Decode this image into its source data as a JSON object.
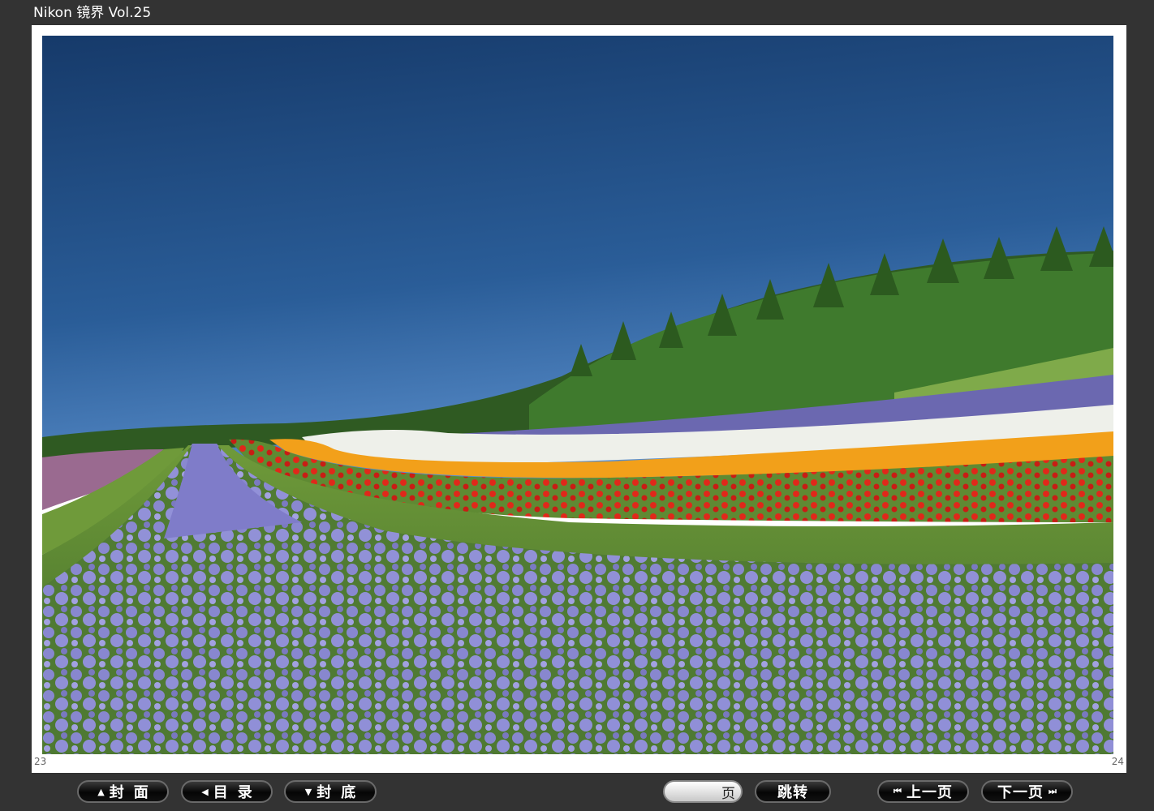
{
  "window": {
    "title": "Nikon 镜界 Vol.25"
  },
  "page": {
    "left_number": "23",
    "right_number": "24",
    "photo_description_icon": "landscape-photo"
  },
  "toolbar": {
    "cover_label": "封面",
    "toc_label": "目录",
    "back_cover_label": "封底",
    "page_input_value": "",
    "page_suffix": "页",
    "jump_label": "跳转",
    "prev_label": "上一页",
    "next_label": "下一页"
  },
  "colors": {
    "background": "#333333",
    "button": "#0a0a0a",
    "page": "#ffffff"
  }
}
